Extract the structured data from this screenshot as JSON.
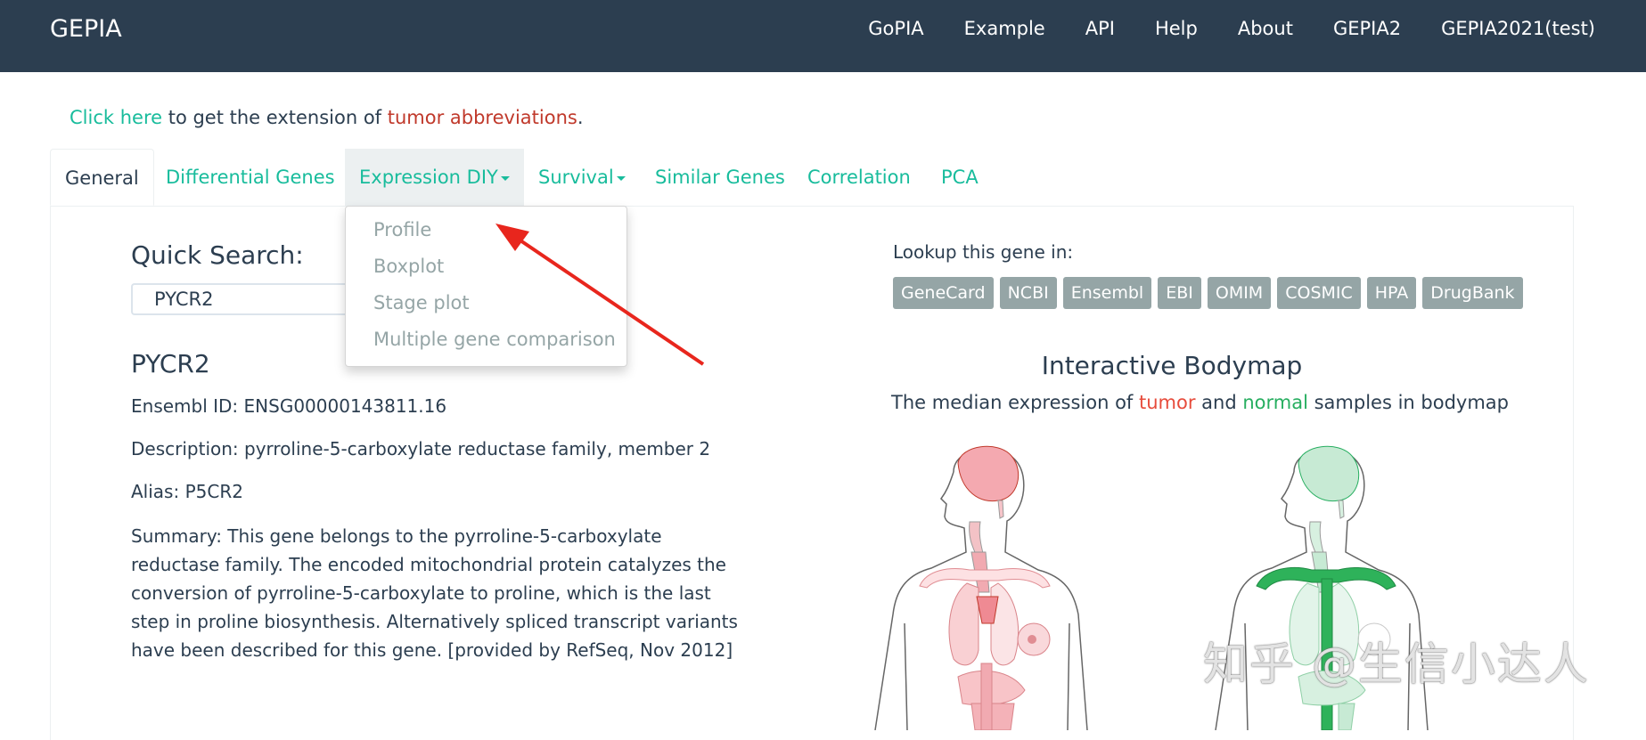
{
  "navbar": {
    "brand": "GEPIA",
    "links": [
      "GoPIA",
      "Example",
      "API",
      "Help",
      "About",
      "GEPIA2",
      "GEPIA2021(test)"
    ]
  },
  "notice": {
    "link": "Click here",
    "middle": " to get the extension of ",
    "abbr": "tumor abbreviations",
    "end": "."
  },
  "tabs": [
    "General",
    "Differential Genes",
    "Expression DIY",
    "Survival",
    "Similar Genes",
    "Correlation",
    "PCA"
  ],
  "dropdown": {
    "items": [
      "Profile",
      "Boxplot",
      "Stage plot",
      "Multiple gene comparison"
    ]
  },
  "quick_search": {
    "label": "Quick Search:",
    "value": "PYCR2"
  },
  "gene": {
    "title": "PYCR2",
    "ensembl": "Ensembl ID: ENSG00000143811.16",
    "description": "Description: pyrroline-5-carboxylate reductase family, member 2",
    "alias": "Alias: P5CR2",
    "summary": "Summary: This gene belongs to the pyrroline-5-carboxylate reductase family. The encoded mitochondrial protein catalyzes the conversion of pyrroline-5-carboxylate to proline, which is the last step in proline biosynthesis. Alternatively spliced transcript variants have been described for this gene. [provided by RefSeq, Nov 2012]"
  },
  "lookup": {
    "label": "Lookup this gene in:",
    "buttons": [
      "GeneCard",
      "NCBI",
      "Ensembl",
      "EBI",
      "OMIM",
      "COSMIC",
      "HPA",
      "DrugBank"
    ]
  },
  "bodymap": {
    "title": "Interactive Bodymap",
    "sub_pre": "The median expression of ",
    "tumor": "tumor",
    "and": " and ",
    "normal": "normal",
    "sub_post": " samples in bodymap"
  },
  "watermark": "知乎 @生信小达人",
  "colors": {
    "navbar": "#2c3e50",
    "link": "#18bc9c",
    "tumor": "#e74c3c",
    "normal": "#27ae60",
    "arrow": "#e8261d"
  }
}
